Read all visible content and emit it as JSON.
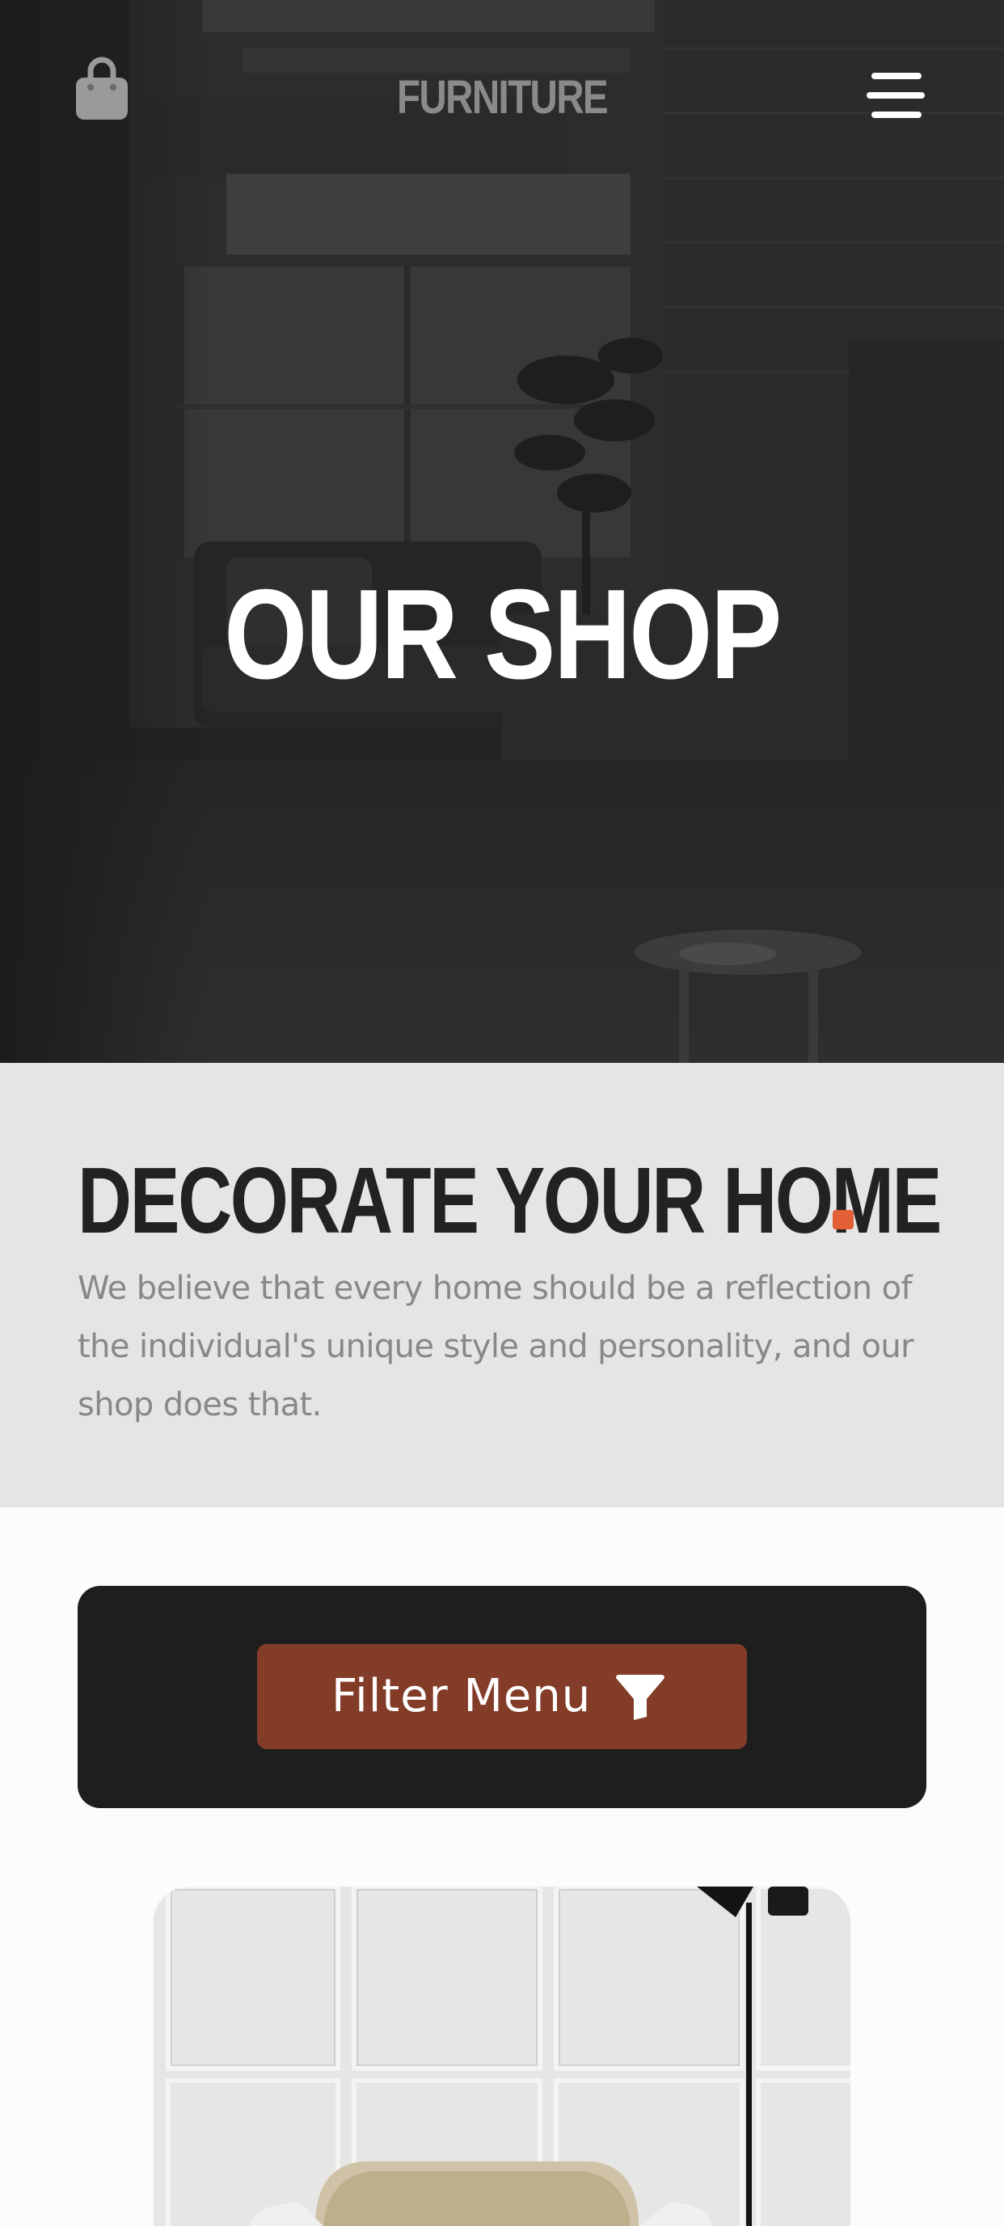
{
  "header": {
    "brand": "FURNITURE",
    "cart_icon": "shopping-bag-icon",
    "menu_icon": "hamburger-menu-icon"
  },
  "hero": {
    "title": "OUR SHOP"
  },
  "intro": {
    "heading": "DECORATE YOUR HOME",
    "text": "We believe that every home should be a reflection of the individual's unique style and personality, and our shop does that."
  },
  "filter": {
    "label": "Filter Menu",
    "icon": "filter-funnel-icon"
  },
  "colors": {
    "accent": "#e35f35",
    "button": "#823c28",
    "panel": "#1f1e1f",
    "intro_bg": "#e6e5e6",
    "page_bg": "#fdfbfb"
  }
}
